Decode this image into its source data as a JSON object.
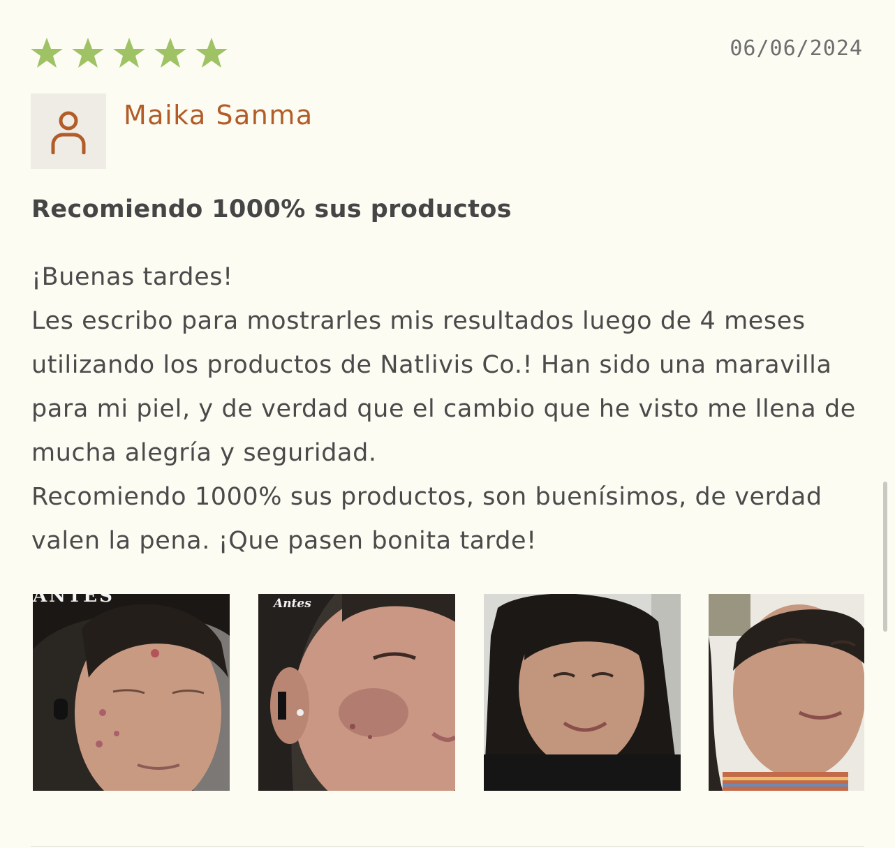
{
  "review": {
    "rating": 5,
    "rating_max": 5,
    "star_color": "#9ec264",
    "date": "06/06/2024",
    "author": "Maika Sanma",
    "author_color": "#b25c28",
    "title": "Recomiendo 1000% sus productos",
    "body_lines": [
      "¡Buenas tardes!",
      "Les escribo para mostrarles mis resultados luego de 4 meses utilizando los productos de Natlivis Co.! Han sido una maravilla para mi piel, y de verdad que el cambio que he visto me llena de mucha alegría y seguridad.",
      "Recomiendo 1000% sus productos, son buenísimos, de verdad valen la pena. ¡Que pasen bonita tarde!"
    ],
    "photos": [
      {
        "label": "ANTES"
      },
      {
        "label": "Antes"
      },
      {
        "label": ""
      },
      {
        "label": ""
      }
    ]
  },
  "icons": {
    "star": "star-icon",
    "avatar": "user-icon"
  }
}
